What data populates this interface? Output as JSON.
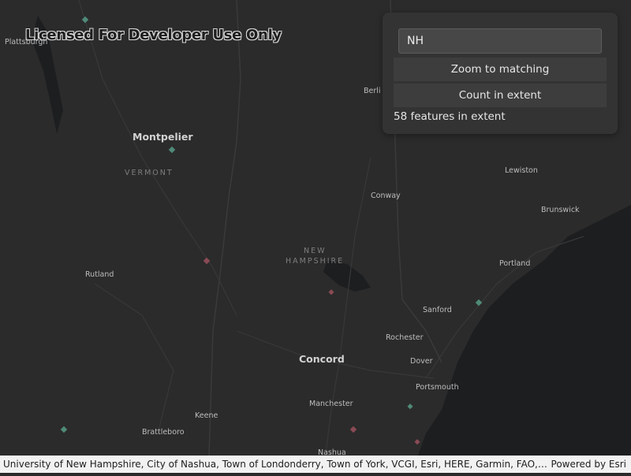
{
  "watermark": "Licensed For Developer Use Only",
  "colors": {
    "land": "#2b2b2b",
    "water": "#1c1e20",
    "roads": "#3c3c3c",
    "feature_red": "#8a4a54",
    "feature_green": "#4f8a78"
  },
  "map_labels": {
    "plattsburgh": "Plattsburgh",
    "montpelier": "Montpelier",
    "vermont": "VERMONT",
    "rutland": "Rutland",
    "new_hampshire_1": "NEW",
    "new_hampshire_2": "HAMPSHIRE",
    "concord": "Concord",
    "keene": "Keene",
    "brattleboro": "Brattleboro",
    "manchester": "Manchester",
    "nashua": "Nashua",
    "berlin": "Berli",
    "conway": "Conway",
    "lewiston": "Lewiston",
    "brunswick": "Brunswick",
    "portland": "Portland",
    "sanford": "Sanford",
    "rochester": "Rochester",
    "dover": "Dover",
    "portsmouth": "Portsmouth"
  },
  "panel": {
    "query_value": "NH",
    "zoom_button": "Zoom to matching",
    "count_button": "Count in extent",
    "result_text": "58 features in extent"
  },
  "attribution": {
    "text": "University of New Hampshire, City of Nashua, Town of Londonderry, Town of York, VCGI, Esri, HERE, Garmin, FAO, NOAA, USGS, EP...",
    "powered_by": "Powered by Esri"
  }
}
